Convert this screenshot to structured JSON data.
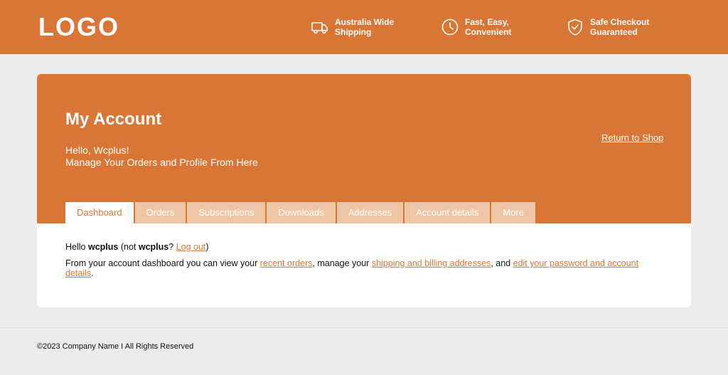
{
  "header": {
    "logo": "LOGO",
    "features": [
      {
        "icon": "truck-icon",
        "text": "Australia Wide\nShipping"
      },
      {
        "icon": "clock-icon",
        "text": "Fast, Easy,\nConvenient"
      },
      {
        "icon": "shield-check-icon",
        "text": "Safe Checkout\nGuaranteed"
      }
    ]
  },
  "account": {
    "title": "My Account",
    "greeting": "Hello, Wcplus!",
    "subtitle": "Manage Your Orders and Profile From Here",
    "return_link": "Return to Shop",
    "tabs": [
      "Dashboard",
      "Orders",
      "Subscriptions",
      "Downloads",
      "Addresses",
      "Account details",
      "More"
    ],
    "active_tab": "Dashboard"
  },
  "dashboard": {
    "hello": "Hello",
    "username": "wcplus",
    "not_open": "(not",
    "not_user": "wcplus",
    "question": "?",
    "logout": "Log out",
    "close_paren": ")",
    "intro": "From your account dashboard you can view your",
    "recent_orders": "recent orders",
    "mid1": ", manage your",
    "addresses_link": "shipping and billing addresses",
    "mid2": ", and",
    "edit_link": "edit your password and account details",
    "end": "."
  },
  "footer": {
    "copyright": "©2023 Company Name I All Rights Reserved"
  },
  "colors": {
    "brand": "#d97636",
    "tab_inactive": "#eec6a6",
    "page_bg": "#ececec"
  }
}
